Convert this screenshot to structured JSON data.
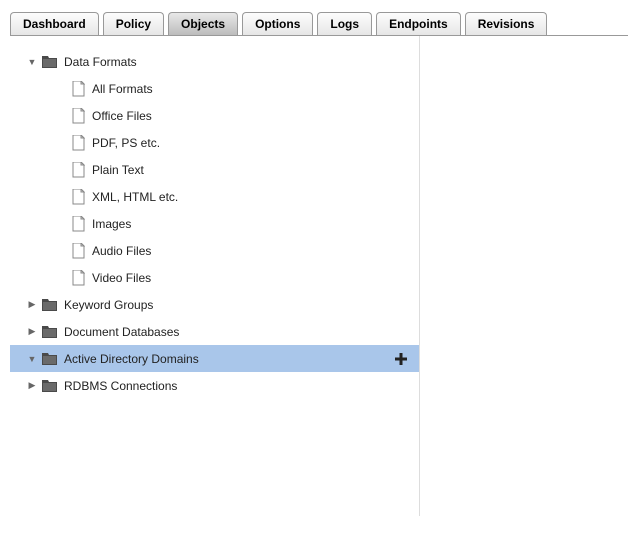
{
  "tabs": {
    "items": [
      {
        "label": "Dashboard"
      },
      {
        "label": "Policy"
      },
      {
        "label": "Objects"
      },
      {
        "label": "Options"
      },
      {
        "label": "Logs"
      },
      {
        "label": "Endpoints"
      },
      {
        "label": "Revisions"
      }
    ],
    "active_index": 2
  },
  "tree": {
    "nodes": [
      {
        "label": "Data Formats",
        "level": 0,
        "kind": "folder",
        "expanded": true,
        "selected": false,
        "action": null
      },
      {
        "label": "All Formats",
        "level": 1,
        "kind": "file",
        "expanded": null,
        "selected": false,
        "action": null
      },
      {
        "label": "Office Files",
        "level": 1,
        "kind": "file",
        "expanded": null,
        "selected": false,
        "action": null
      },
      {
        "label": "PDF, PS etc.",
        "level": 1,
        "kind": "file",
        "expanded": null,
        "selected": false,
        "action": null
      },
      {
        "label": "Plain Text",
        "level": 1,
        "kind": "file",
        "expanded": null,
        "selected": false,
        "action": null
      },
      {
        "label": "XML, HTML etc.",
        "level": 1,
        "kind": "file",
        "expanded": null,
        "selected": false,
        "action": null
      },
      {
        "label": "Images",
        "level": 1,
        "kind": "file",
        "expanded": null,
        "selected": false,
        "action": null
      },
      {
        "label": "Audio Files",
        "level": 1,
        "kind": "file",
        "expanded": null,
        "selected": false,
        "action": null
      },
      {
        "label": "Video Files",
        "level": 1,
        "kind": "file",
        "expanded": null,
        "selected": false,
        "action": null
      },
      {
        "label": "Keyword Groups",
        "level": 0,
        "kind": "folder",
        "expanded": false,
        "selected": false,
        "action": null
      },
      {
        "label": "Document Databases",
        "level": 0,
        "kind": "folder",
        "expanded": false,
        "selected": false,
        "action": null
      },
      {
        "label": "Active Directory Domains",
        "level": 0,
        "kind": "folder",
        "expanded": true,
        "selected": true,
        "action": "add"
      },
      {
        "label": "RDBMS Connections",
        "level": 0,
        "kind": "folder",
        "expanded": false,
        "selected": false,
        "action": null
      }
    ]
  },
  "icons": {
    "triangle_right": "▶",
    "triangle_down": "▼"
  }
}
